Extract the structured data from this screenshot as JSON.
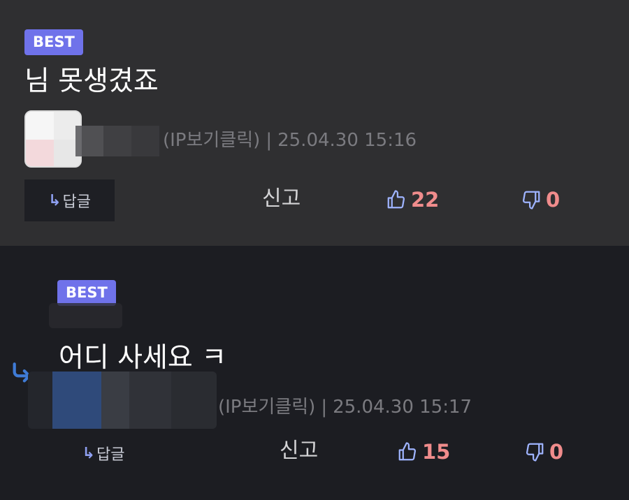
{
  "comments": [
    {
      "badge": "BEST",
      "text": "님 못생겼죠",
      "meta_ip": "(IP보기클릭)",
      "meta_sep": "|",
      "timestamp": "25.04.30 15:16",
      "reply_label": "답글",
      "report_label": "신고",
      "likes": "22",
      "dislikes": "0"
    },
    {
      "badge": "BEST",
      "text": "어디 사세요 ㅋ",
      "meta_ip": "(IP보기클릭)",
      "meta_sep": "|",
      "timestamp": "25.04.30 15:17",
      "reply_label": "답글",
      "report_label": "신고",
      "likes": "15",
      "dislikes": "0"
    }
  ],
  "icons": {
    "reply_arrow": "↳",
    "like": "thumbs-up-icon",
    "dislike": "thumbs-down-icon",
    "thread": "thread-reply-icon"
  },
  "colors": {
    "badge": "#6f72ea",
    "count": "#f08c8c",
    "icon": "#9fb4ff",
    "thread_arrow": "#3f7bd6"
  }
}
